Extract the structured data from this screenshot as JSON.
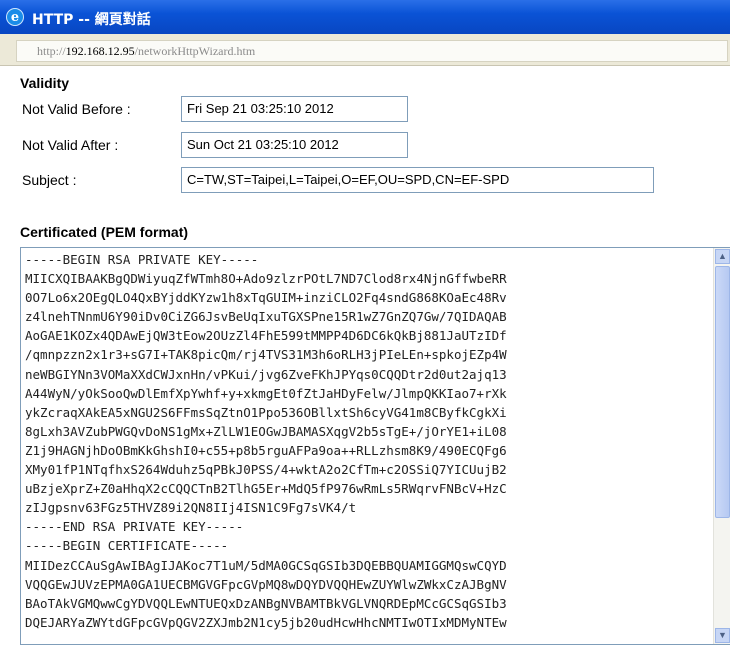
{
  "window": {
    "title": "HTTP -- 網頁對話",
    "icon": "ie-icon"
  },
  "address": {
    "prefix": "http://",
    "host": "192.168.12.95",
    "path": "/networkHttpWizard.htm"
  },
  "validity": {
    "heading": "Validity",
    "not_valid_before_label": "Not Valid Before :",
    "not_valid_before_value": "Fri Sep 21 03:25:10 2012",
    "not_valid_after_label": "Not Valid After :",
    "not_valid_after_value": "Sun Oct 21 03:25:10 2012",
    "subject_label": "Subject :",
    "subject_value": "C=TW,ST=Taipei,L=Taipei,O=EF,OU=SPD,CN=EF-SPD"
  },
  "certificate": {
    "heading": "Certificated (PEM format)",
    "pem": "-----BEGIN RSA PRIVATE KEY-----\nMIICXQIBAAKBgQDWiyuqZfWTmh8O+Ado9zlzrPOtL7ND7Clod8rx4NjnGffwbeRR\n0O7Lo6x2OEgQLO4QxBYjddKYzw1h8xTqGUIM+inziCLO2Fq4sndG868KOaEc48Rv\nz4lnehTNnmU6Y90iDv0CiZG6JsvBeUqIxuTGXSPne15R1wZ7GnZQ7Gw/7QIDAQAB\nAoGAE1KOZx4QDAwEjQW3tEow2OUzZl4FhE599tMMPP4D6DC6kQkBj881JaUTzIDf\n/qmnpzzn2x1r3+sG7I+TAK8picQm/rj4TVS31M3h6oRLH3jPIeLEn+spkojEZp4W\nneWBGIYNn3VOMaXXdCWJxnHn/vPKui/jvg6ZveFKhJPYqs0CQQDtr2d0ut2ajq13\nA44WyN/yOkSooQwDlEmfXpYwhf+y+xkmgEt0fZtJaHDyFelw/JlmpQKKIao7+rXk\nykZcraqXAkEA5xNGU2S6FFmsSqZtnO1Ppo536OBllxtSh6cyVG41m8CByfkCgkXi\n8gLxh3AVZubPWGQvDoNS1gMx+ZlLW1EOGwJBAMASXqgV2b5sTgE+/jOrYE1+iL08\nZ1j9HAGNjhDoOBmKkGhshI0+c55+p8b5rguAFPa9oa++RLLzhsm8K9/490ECQFg6\nXMy01fP1NTqfhxS264Wduhz5qPBkJ0PSS/4+wktA2o2CfTm+c2OSSiQ7YICUujB2\nuBzjeXprZ+Z0aHhqX2cCQQCTnB2TlhG5Er+MdQ5fP976wRmLs5RWqrvFNBcV+HzC\nzIJgpsnv63FGz5THVZ89i2QN8IIj4ISN1C9Fg7sVK4/t\n-----END RSA PRIVATE KEY-----\n-----BEGIN CERTIFICATE-----\nMIIDezCCAuSgAwIBAgIJAKoc7T1uM/5dMA0GCSqGSIb3DQEBBQUAMIGGMQswCQYD\nVQQGEwJUVzEPMA0GA1UECBMGVGFpcGVpMQ8wDQYDVQQHEwZUYWlwZWkxCzAJBgNV\nBAoTAkVGMQwwCgYDVQQLEwNTUEQxDzANBgNVBAMTBkVGLVNQRDEpMCcGCSqGSIb3\nDQEJARYaZWYtdGFpcGVpQGV2ZXJmb2N1cy5jb20udHcwHhcNMTIwOTIxMDMyNTEw"
  },
  "colors": {
    "titlebar": "#0a53d6",
    "field_border": "#7f9db9",
    "address_bg": "#ece9d8"
  }
}
